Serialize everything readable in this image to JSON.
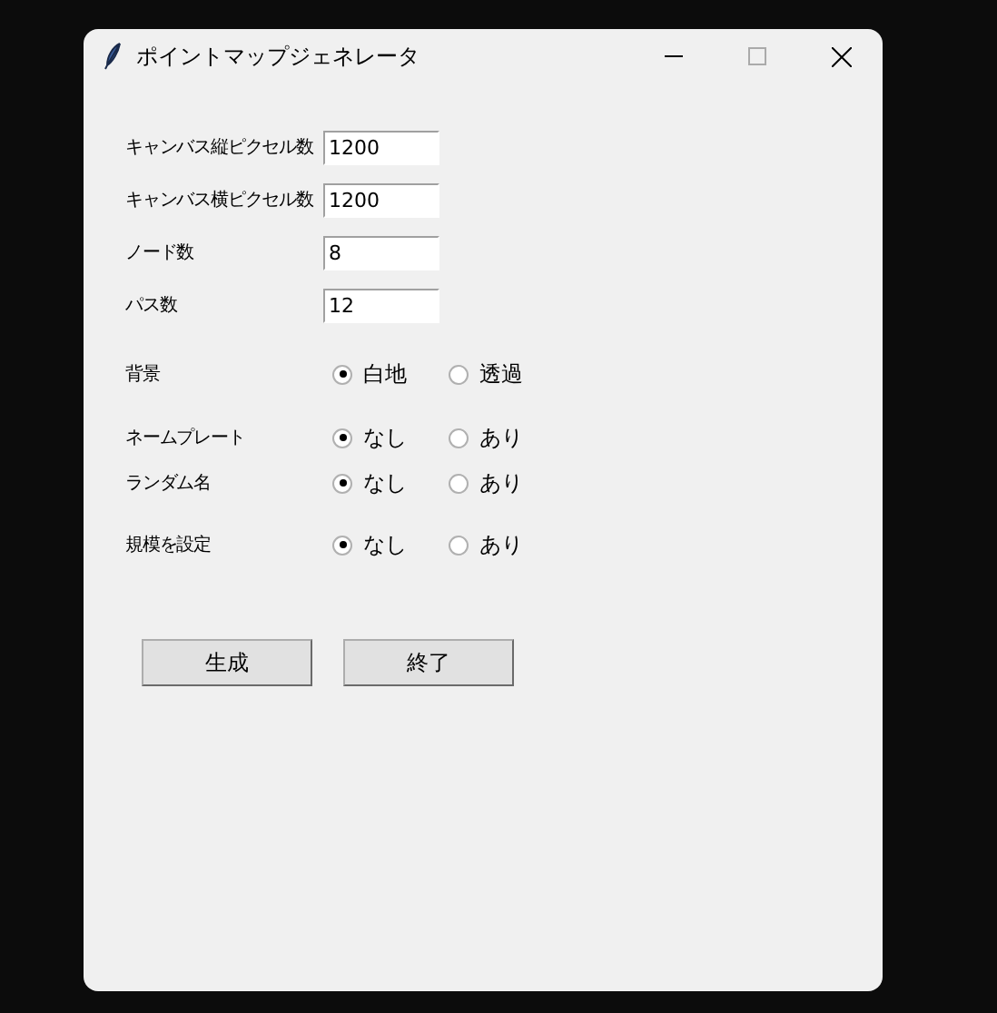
{
  "window": {
    "title": "ポイントマップジェネレータ"
  },
  "fields": [
    {
      "label": "キャンバス縦ピクセル数",
      "value": "1200"
    },
    {
      "label": "キャンバス横ピクセル数",
      "value": "1200"
    },
    {
      "label": "ノード数",
      "value": "8"
    },
    {
      "label": "パス数",
      "value": "12"
    }
  ],
  "options": [
    {
      "label": "背景",
      "choices": [
        {
          "label": "白地",
          "selected": true
        },
        {
          "label": "透過",
          "selected": false
        }
      ]
    },
    {
      "label": "ネームプレート",
      "choices": [
        {
          "label": "なし",
          "selected": true
        },
        {
          "label": "あり",
          "selected": false
        }
      ]
    },
    {
      "label": "ランダム名",
      "choices": [
        {
          "label": "なし",
          "selected": true
        },
        {
          "label": "あり",
          "selected": false
        }
      ]
    },
    {
      "label": "規模を設定",
      "choices": [
        {
          "label": "なし",
          "selected": true
        },
        {
          "label": "あり",
          "selected": false
        }
      ]
    }
  ],
  "buttons": [
    "生成",
    "終了"
  ]
}
